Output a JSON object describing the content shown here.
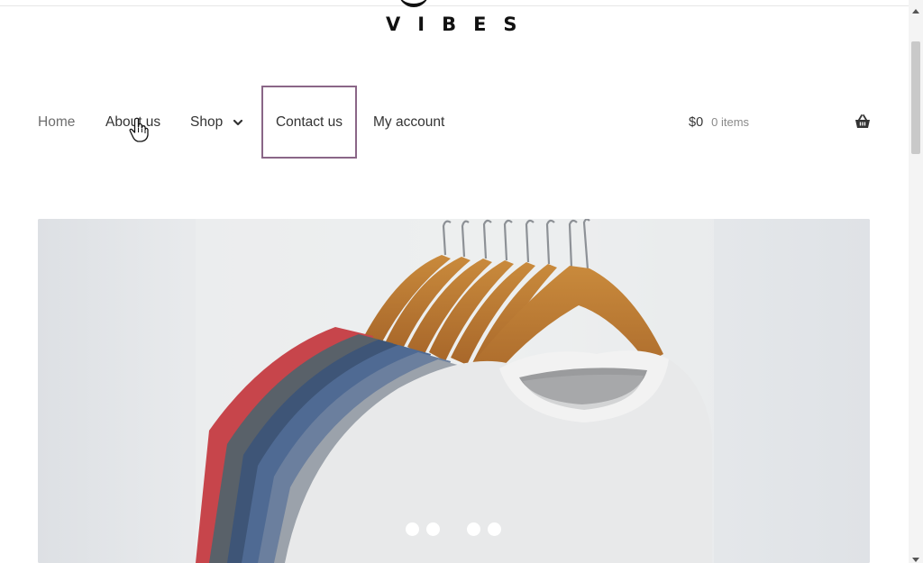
{
  "site": {
    "logo_word": "VIBES"
  },
  "nav": {
    "items": [
      {
        "label": "Home"
      },
      {
        "label": "About us"
      },
      {
        "label": "Shop"
      },
      {
        "label": "Contact us"
      },
      {
        "label": "My account"
      }
    ],
    "shop_icon": "chevron-down-icon"
  },
  "cart": {
    "amount": "$0",
    "count": "0 items",
    "icon": "basket-icon"
  },
  "hero": {
    "image": "t-shirts-on-wooden-hangers",
    "dots_count": 4
  },
  "colors": {
    "active_border": "#8a6687",
    "text": "#333333",
    "muted": "#8a8a8a"
  }
}
